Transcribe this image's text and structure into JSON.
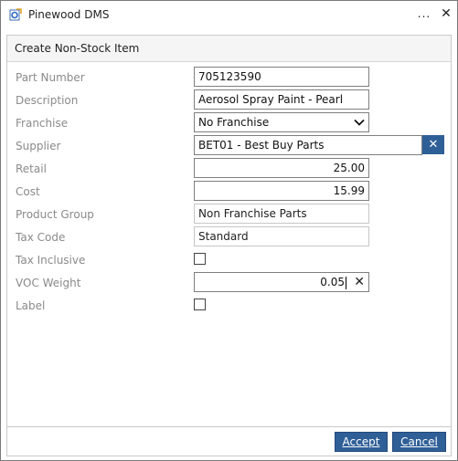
{
  "window": {
    "title": "Pinewood DMS",
    "more_label": "...",
    "close_label": "✕"
  },
  "form": {
    "header": "Create Non-Stock Item",
    "fields": {
      "part_number": {
        "label": "Part Number",
        "value": "705123590"
      },
      "description": {
        "label": "Description",
        "value": "Aerosol Spray Paint - Pearl"
      },
      "franchise": {
        "label": "Franchise",
        "value": "No Franchise"
      },
      "supplier": {
        "label": "Supplier",
        "value": "BET01 - Best Buy Parts"
      },
      "retail": {
        "label": "Retail",
        "value": "25.00"
      },
      "cost": {
        "label": "Cost",
        "value": "15.99"
      },
      "product_group": {
        "label": "Product Group",
        "value": "Non Franchise Parts"
      },
      "tax_code": {
        "label": "Tax Code",
        "value": "Standard"
      },
      "tax_inclusive": {
        "label": "Tax Inclusive",
        "checked": false
      },
      "voc_weight": {
        "label": "VOC Weight",
        "value": "0.05"
      },
      "label": {
        "label": "Label",
        "checked": false
      }
    },
    "supplier_clear_icon": "clear-icon",
    "voc_clear_icon": "clear-icon"
  },
  "buttons": {
    "accept": "Accept",
    "cancel": "Cancel"
  },
  "colors": {
    "accent": "#2f5f97",
    "label_text": "#8a8a8a"
  }
}
